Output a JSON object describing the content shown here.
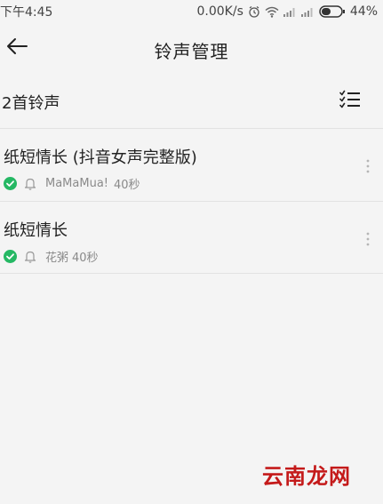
{
  "status_bar": {
    "time": "下午4:45",
    "network_speed": "0.00K/s",
    "battery": "44%",
    "icons": [
      "alarm-icon",
      "wifi-icon",
      "signal-icon",
      "signal-icon",
      "battery-icon"
    ]
  },
  "header": {
    "title": "铃声管理",
    "back_icon": "arrow-left-icon"
  },
  "summary": {
    "count_label": "2首铃声",
    "menu_icon": "checklist-icon"
  },
  "ringtones": [
    {
      "title": "纸短情长 (抖音女声完整版)",
      "artist": "MaMaMua!",
      "duration": "40秒",
      "selected": true
    },
    {
      "title": "纸短情长",
      "artist": "花粥",
      "duration": "40秒",
      "selected": true
    }
  ],
  "watermark": "云南龙网",
  "colors": {
    "accent_green": "#25b864",
    "background": "#f4f4f4",
    "divider": "#e2e2e2",
    "watermark_red": "#c41a1a"
  }
}
